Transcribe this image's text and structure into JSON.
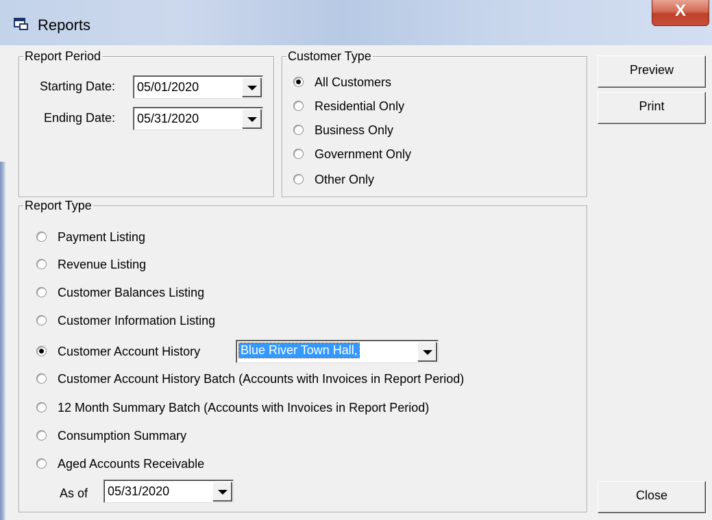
{
  "window": {
    "title": "Reports",
    "close_glyph": "X"
  },
  "report_period": {
    "legend": "Report Period",
    "starting_label": "Starting Date:",
    "starting_value": "05/01/2020",
    "ending_label": "Ending Date:",
    "ending_value": "05/31/2020"
  },
  "customer_type": {
    "legend": "Customer Type",
    "options": [
      {
        "label": "All Customers",
        "selected": true
      },
      {
        "label": "Residential Only",
        "selected": false
      },
      {
        "label": "Business Only",
        "selected": false
      },
      {
        "label": "Government Only",
        "selected": false
      },
      {
        "label": "Other Only",
        "selected": false
      }
    ]
  },
  "report_type": {
    "legend": "Report Type",
    "options": [
      {
        "label": "Payment Listing",
        "selected": false
      },
      {
        "label": "Revenue Listing",
        "selected": false
      },
      {
        "label": "Customer Balances Listing",
        "selected": false
      },
      {
        "label": "Customer Information Listing",
        "selected": false
      },
      {
        "label": "Customer Account History",
        "selected": true
      },
      {
        "label": "Customer Account History Batch (Accounts with Invoices in Report Period)",
        "selected": false
      },
      {
        "label": "12 Month Summary Batch (Accounts with Invoices in Report Period)",
        "selected": false
      },
      {
        "label": "Consumption Summary",
        "selected": false
      },
      {
        "label": "Aged Accounts Receivable",
        "selected": false
      }
    ],
    "account_combo_value": "Blue River Town Hall,",
    "as_of_label": "As of",
    "as_of_value": "05/31/2020"
  },
  "buttons": {
    "preview": "Preview",
    "print": "Print",
    "close": "Close"
  },
  "icons": {
    "title": "window-app-icon",
    "dropdown": "chevron-down-icon"
  }
}
